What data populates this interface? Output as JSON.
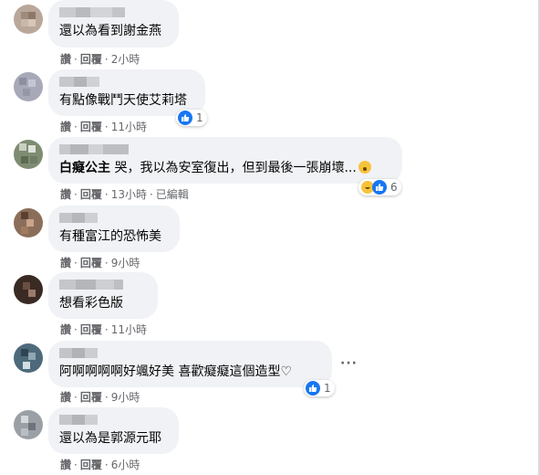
{
  "actions": {
    "like": "讚",
    "reply": "回覆",
    "dot": "·",
    "edited": "已編輯"
  },
  "comments": [
    {
      "text": "還以為看到謝金燕",
      "time": "2小時"
    },
    {
      "text": "有點像戰鬥天使艾莉塔",
      "time": "11小時",
      "reactions": "1"
    },
    {
      "tag": "白癡公主",
      "text": " 哭，我以為安室復出，但到最後一張崩壞...",
      "time": "13小時",
      "reactions": "6"
    },
    {
      "text": "有種富江的恐怖美",
      "time": "9小時"
    },
    {
      "text": "想看彩色版",
      "time": "11小時"
    },
    {
      "text": "阿啊啊啊啊好颯好美 喜歡癡癡這個造型♡",
      "time": "9小時",
      "reactions": "1",
      "more": "···"
    },
    {
      "text": "還以為是郭源元耶",
      "time": "6小時"
    }
  ]
}
